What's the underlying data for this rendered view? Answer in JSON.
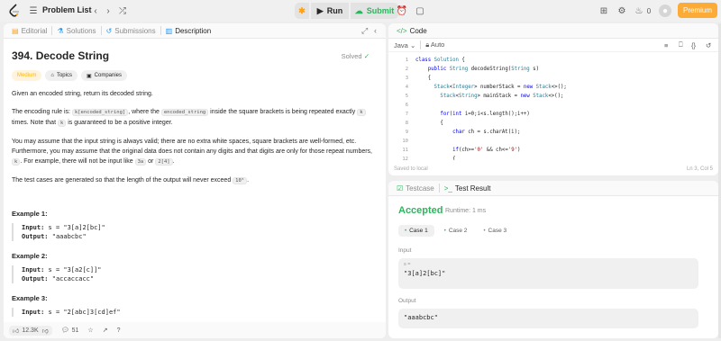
{
  "topbar": {
    "problem_list_label": "Problem List",
    "run_label": "Run",
    "submit_label": "Submit",
    "streak_count": "0",
    "premium_label": "Premium"
  },
  "left_tabs": [
    {
      "label": "Editorial",
      "icon": "editorial-icon"
    },
    {
      "label": "Solutions",
      "icon": "solutions-icon"
    },
    {
      "label": "Submissions",
      "icon": "submissions-icon"
    },
    {
      "label": "Description",
      "icon": "description-icon"
    }
  ],
  "problem": {
    "title": "394. Decode String",
    "solved_label": "Solved",
    "difficulty": "Medium",
    "topics_label": "Topics",
    "companies_label": "Companies",
    "intro": "Given an encoded string, return its decoded string.",
    "rule_a": "The encoding rule is:",
    "rule_code1": "k[encoded_string]",
    "rule_b": ", where the",
    "rule_code2": "encoded_string",
    "rule_c": "inside the square brackets is being repeated exactly",
    "rule_code3": "k",
    "rule_d": "times. Note that",
    "rule_code4": "k",
    "rule_e": "is guaranteed to be a positive integer.",
    "assume_a": "You may assume that the input string is always valid; there are no extra white spaces, square brackets are well-formed, etc. Furthermore, you may assume that the original data does not contain any digits and that digits are only for those repeat numbers,",
    "assume_code1": "k",
    "assume_b": ". For example, there will not be input like",
    "assume_code2": "3a",
    "assume_c": "or",
    "assume_code3": "2[4]",
    "assume_d": ".",
    "generated_a": "The test cases are generated so that the length of the output will never exceed",
    "generated_code": "10⁵",
    "generated_b": ".",
    "examples": [
      {
        "title": "Example 1:",
        "input_label": "Input:",
        "input": "s = \"3[a]2[bc]\"",
        "output_label": "Output:",
        "output": "\"aaabcbc\""
      },
      {
        "title": "Example 2:",
        "input_label": "Input:",
        "input": "s = \"3[a2[c]]\"",
        "output_label": "Output:",
        "output": "\"accaccacc\""
      },
      {
        "title": "Example 3:",
        "input_label": "Input:",
        "input": "s = \"2[abc]3[cd]ef\""
      }
    ]
  },
  "footer": {
    "likes": "12.3K",
    "comments": "51"
  },
  "code_panel": {
    "tab_label": "Code",
    "language": "Java",
    "mode": "Auto",
    "saved_label": "Saved to local",
    "cursor_pos": "Ln 3, Col 5",
    "lines": [
      {
        "n": "1",
        "text": "class Solution {"
      },
      {
        "n": "2",
        "text": "    public String decodeString(String s)"
      },
      {
        "n": "3",
        "text": "    {"
      },
      {
        "n": "4",
        "text": "      Stack<Integer> numberStack = new Stack<>();"
      },
      {
        "n": "5",
        "text": "        Stack<String> mainStack = new Stack<>();"
      },
      {
        "n": "6",
        "text": ""
      },
      {
        "n": "7",
        "text": "        for(int i=0;i<s.length();i++)"
      },
      {
        "n": "8",
        "text": "        {"
      },
      {
        "n": "9",
        "text": "            char ch = s.charAt(i);"
      },
      {
        "n": "10",
        "text": ""
      },
      {
        "n": "11",
        "text": "            if(ch>='0' && ch<='9')"
      },
      {
        "n": "12",
        "text": "            {"
      }
    ]
  },
  "result_panel": {
    "testcase_tab": "Testcase",
    "result_tab": "Test Result",
    "status": "Accepted",
    "runtime": "Runtime: 1 ms",
    "cases": [
      "Case 1",
      "Case 2",
      "Case 3"
    ],
    "input_label": "Input",
    "input_var": "s =",
    "input_value": "\"3[a]2[bc]\"",
    "output_label": "Output",
    "output_value": "\"aaabcbc\""
  },
  "colors": {
    "accent_green": "#2db55d",
    "premium_orange": "#ffa116",
    "medium_yellow": "#ffb800"
  }
}
